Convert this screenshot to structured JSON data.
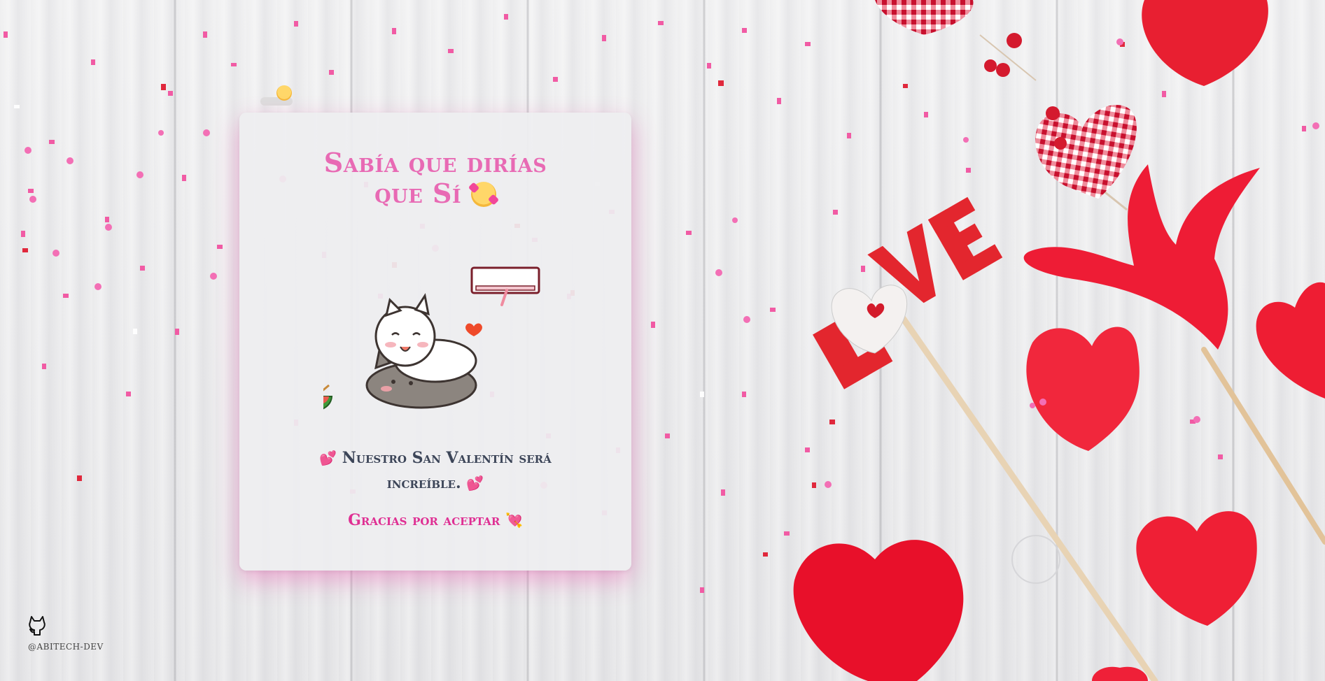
{
  "card": {
    "title_line1": "Sabía que dirías",
    "title_line2": "que Sí",
    "message": "Nuestro San Valentín será increíble.",
    "thanks": "Gracias por aceptar"
  },
  "footer": {
    "handle": "@ABITECH-DEV"
  },
  "icons": {
    "github": "github-icon",
    "title_emoji": "smiling-face-with-hearts-icon",
    "message_emoji": "two-hearts-icon",
    "thanks_emoji": "heart-with-arrow-icon"
  },
  "colors": {
    "title": "#e86ab4",
    "message": "#3c4558",
    "thanks": "#df2f93",
    "card_glow": "#ec5aaf"
  }
}
